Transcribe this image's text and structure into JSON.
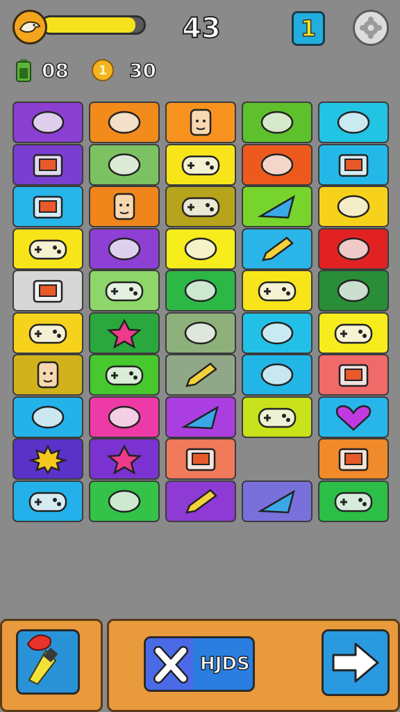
{
  "hud": {
    "score": "43",
    "level": "1",
    "hp_fraction": 0.92,
    "battery_value": "08",
    "coins_value": "30",
    "coin_symbol": "1"
  },
  "colors": {
    "background": "#8a8a8a",
    "hp_fill": "#f6e21c",
    "panel": "#e99a3c",
    "button_blue": "#2a93d8"
  },
  "tiles": [
    {
      "bg": "#8b3fd1",
      "icon": "headphones-icon"
    },
    {
      "bg": "#f28a1c",
      "icon": "cloud-icon"
    },
    {
      "bg": "#f7921f",
      "icon": "face-icon"
    },
    {
      "bg": "#5ec02c",
      "icon": "dumbbell-icon"
    },
    {
      "bg": "#22c4e4",
      "icon": "chat-leaf-icon"
    },
    {
      "bg": "#7a3ed0",
      "icon": "tv-icon"
    },
    {
      "bg": "#7cc262",
      "icon": "arrow-icon"
    },
    {
      "bg": "#f7e51a",
      "icon": "gamepad-icon"
    },
    {
      "bg": "#ee5a1e",
      "icon": "lollipop-icon"
    },
    {
      "bg": "#24b8e8",
      "icon": "battery-icon"
    },
    {
      "bg": "#28b6ea",
      "icon": "camera-icon"
    },
    {
      "bg": "#f0851c",
      "icon": "blob-face-icon"
    },
    {
      "bg": "#b5a41c",
      "icon": "controller-icon"
    },
    {
      "bg": "#76d42c",
      "icon": "triangle-icon"
    },
    {
      "bg": "#f7d21c",
      "icon": "cloud-small-icon"
    },
    {
      "bg": "#f7e51a",
      "icon": "gamepad-pink-icon"
    },
    {
      "bg": "#8e3fd4",
      "icon": "blob-purple-icon"
    },
    {
      "bg": "#f7ec1c",
      "icon": "gem-icon"
    },
    {
      "bg": "#2ab4e8",
      "icon": "wand-icon"
    },
    {
      "bg": "#e22222",
      "icon": "bow-icon"
    },
    {
      "bg": "#d6d6d6",
      "icon": "handheld-icon"
    },
    {
      "bg": "#8ed66a",
      "icon": "gamepad-green-icon"
    },
    {
      "bg": "#2db846",
      "icon": "bush-icon"
    },
    {
      "bg": "#f7e51a",
      "icon": "gamepad-red-icon"
    },
    {
      "bg": "#2a8e38",
      "icon": "gears-icon"
    },
    {
      "bg": "#f7d21c",
      "icon": "controller-green-icon"
    },
    {
      "bg": "#2aa83e",
      "icon": "star-pink-icon"
    },
    {
      "bg": "#8eb07a",
      "icon": "orb-icon"
    },
    {
      "bg": "#22c0e6",
      "icon": "safety-pin-icon"
    },
    {
      "bg": "#f7ec1c",
      "icon": "gamepad-blue-icon"
    },
    {
      "bg": "#d1b21c",
      "icon": "redhead-icon"
    },
    {
      "bg": "#46c82e",
      "icon": "gamepad-tilted-icon"
    },
    {
      "bg": "#90a888",
      "icon": "lipstick-icon"
    },
    {
      "bg": "#22b6e6",
      "icon": "roller-icon"
    },
    {
      "bg": "#f06a6a",
      "icon": "calculator-icon"
    },
    {
      "bg": "#24b2ea",
      "icon": "bean-icon"
    },
    {
      "bg": "#ee3aa6",
      "icon": "whistle-icon"
    },
    {
      "bg": "#aa3ee0",
      "icon": "arrowhead-icon"
    },
    {
      "bg": "#c8e21c",
      "icon": "gamepad-yellow-icon"
    },
    {
      "bg": "#28b6ea",
      "icon": "heart-icon"
    },
    {
      "bg": "#5a32c8",
      "icon": "sun-icon"
    },
    {
      "bg": "#7a32d0",
      "icon": "star-white-icon"
    },
    {
      "bg": "#f07a5a",
      "icon": "frame-icon"
    },
    {
      "bg": "",
      "icon": ""
    },
    {
      "bg": "#f08a2a",
      "icon": "radio-icon"
    },
    {
      "bg": "#24b0ea",
      "icon": "gamepad-purple-icon"
    },
    {
      "bg": "#34c248",
      "icon": "pill-icon"
    },
    {
      "bg": "#8e3ad4",
      "icon": "pencil-icon"
    },
    {
      "bg": "#7a70dc",
      "icon": "slide-icon"
    },
    {
      "bg": "#2cbe46",
      "icon": "gamepad-red2-icon"
    }
  ],
  "bottom": {
    "action_label": "HJDS"
  }
}
